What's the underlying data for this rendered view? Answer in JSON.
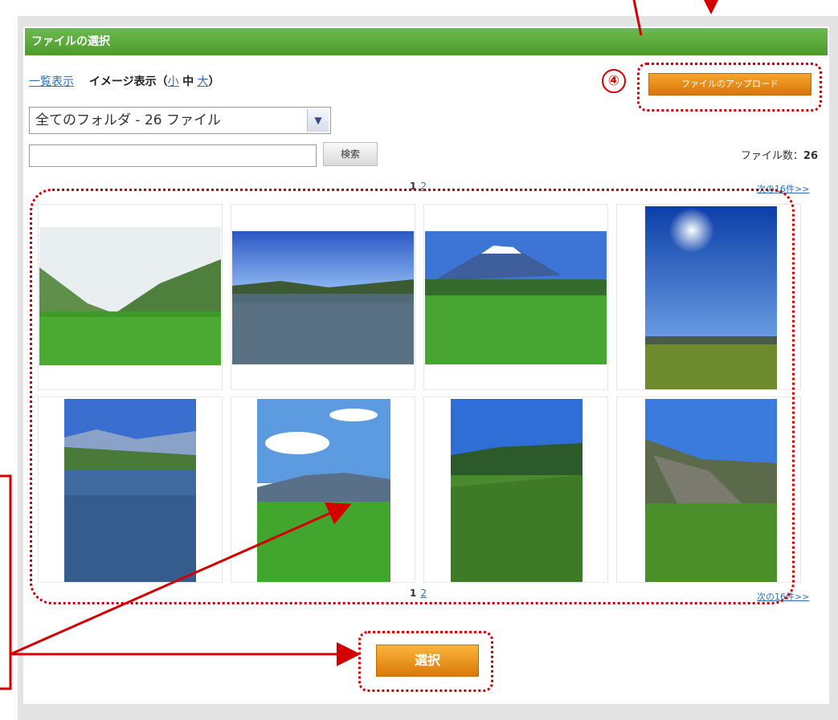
{
  "title": "ファイルの選択",
  "view_bar": {
    "list_view": "一覧表示",
    "image_view_prefix": "イメージ表示（",
    "size_small": "小",
    "size_medium": "中",
    "size_large": "大",
    "image_view_suffix": "）"
  },
  "folder_select": {
    "value": "全てのフォルダ - 26 ファイル"
  },
  "search": {
    "placeholder": "",
    "button_label": "検索"
  },
  "upload_button": "ファイルのアップロード",
  "file_count": {
    "label": "ファイル数：",
    "value": "26"
  },
  "pager": {
    "current": "1",
    "other": "2",
    "next_link": "次の16件>>"
  },
  "thumbnails": [
    {
      "name": "valley-rice-field"
    },
    {
      "name": "flooded-paddy"
    },
    {
      "name": "mount-fuji-field"
    },
    {
      "name": "sun-over-field"
    },
    {
      "name": "mountain-reflection-paddy"
    },
    {
      "name": "clouds-over-green-field"
    },
    {
      "name": "hillside-rice"
    },
    {
      "name": "stone-wall-terrace"
    }
  ],
  "select_button": "選択",
  "annotations": {
    "badge": "④"
  },
  "colors": {
    "title_bar": "#5aa83a",
    "button_orange": "#e88b1a",
    "annotation_red": "#d40000"
  }
}
